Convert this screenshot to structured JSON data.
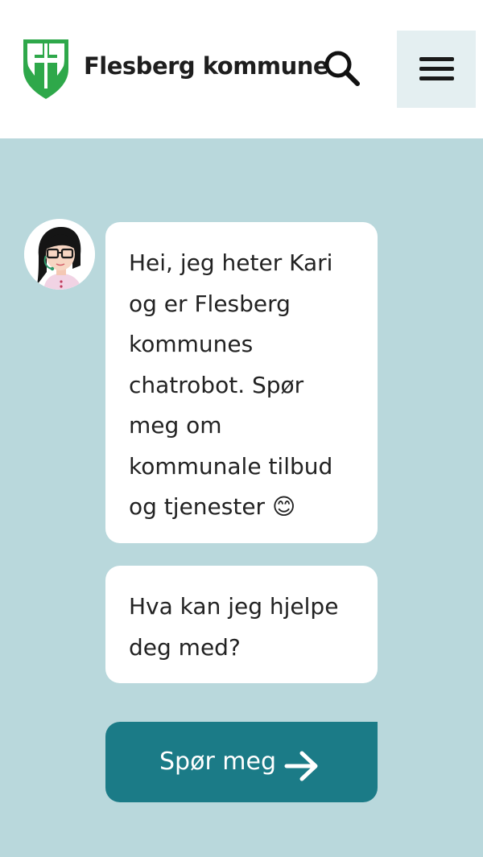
{
  "header": {
    "brand_name": "Flesberg kommune",
    "logo": "flesberg-coat-of-arms",
    "search_icon": "search-icon",
    "menu_icon": "hamburger-menu-icon"
  },
  "chat": {
    "avatar": "chatbot-avatar-kari",
    "messages": [
      {
        "text": "Hei, jeg heter Kari og er Flesberg kommunes chatrobot. Spør meg om kommunale tilbud og tjenester 😊"
      },
      {
        "text": "Hva kan jeg hjelpe deg med?"
      }
    ],
    "cta": {
      "label": "Spør meg",
      "icon": "arrow-right-icon"
    }
  },
  "colors": {
    "page_background": "#b9d8dc",
    "header_background": "#ffffff",
    "menu_button_background": "#e4eff1",
    "cta_background": "#1b7b87",
    "logo_green": "#2ea84a"
  }
}
